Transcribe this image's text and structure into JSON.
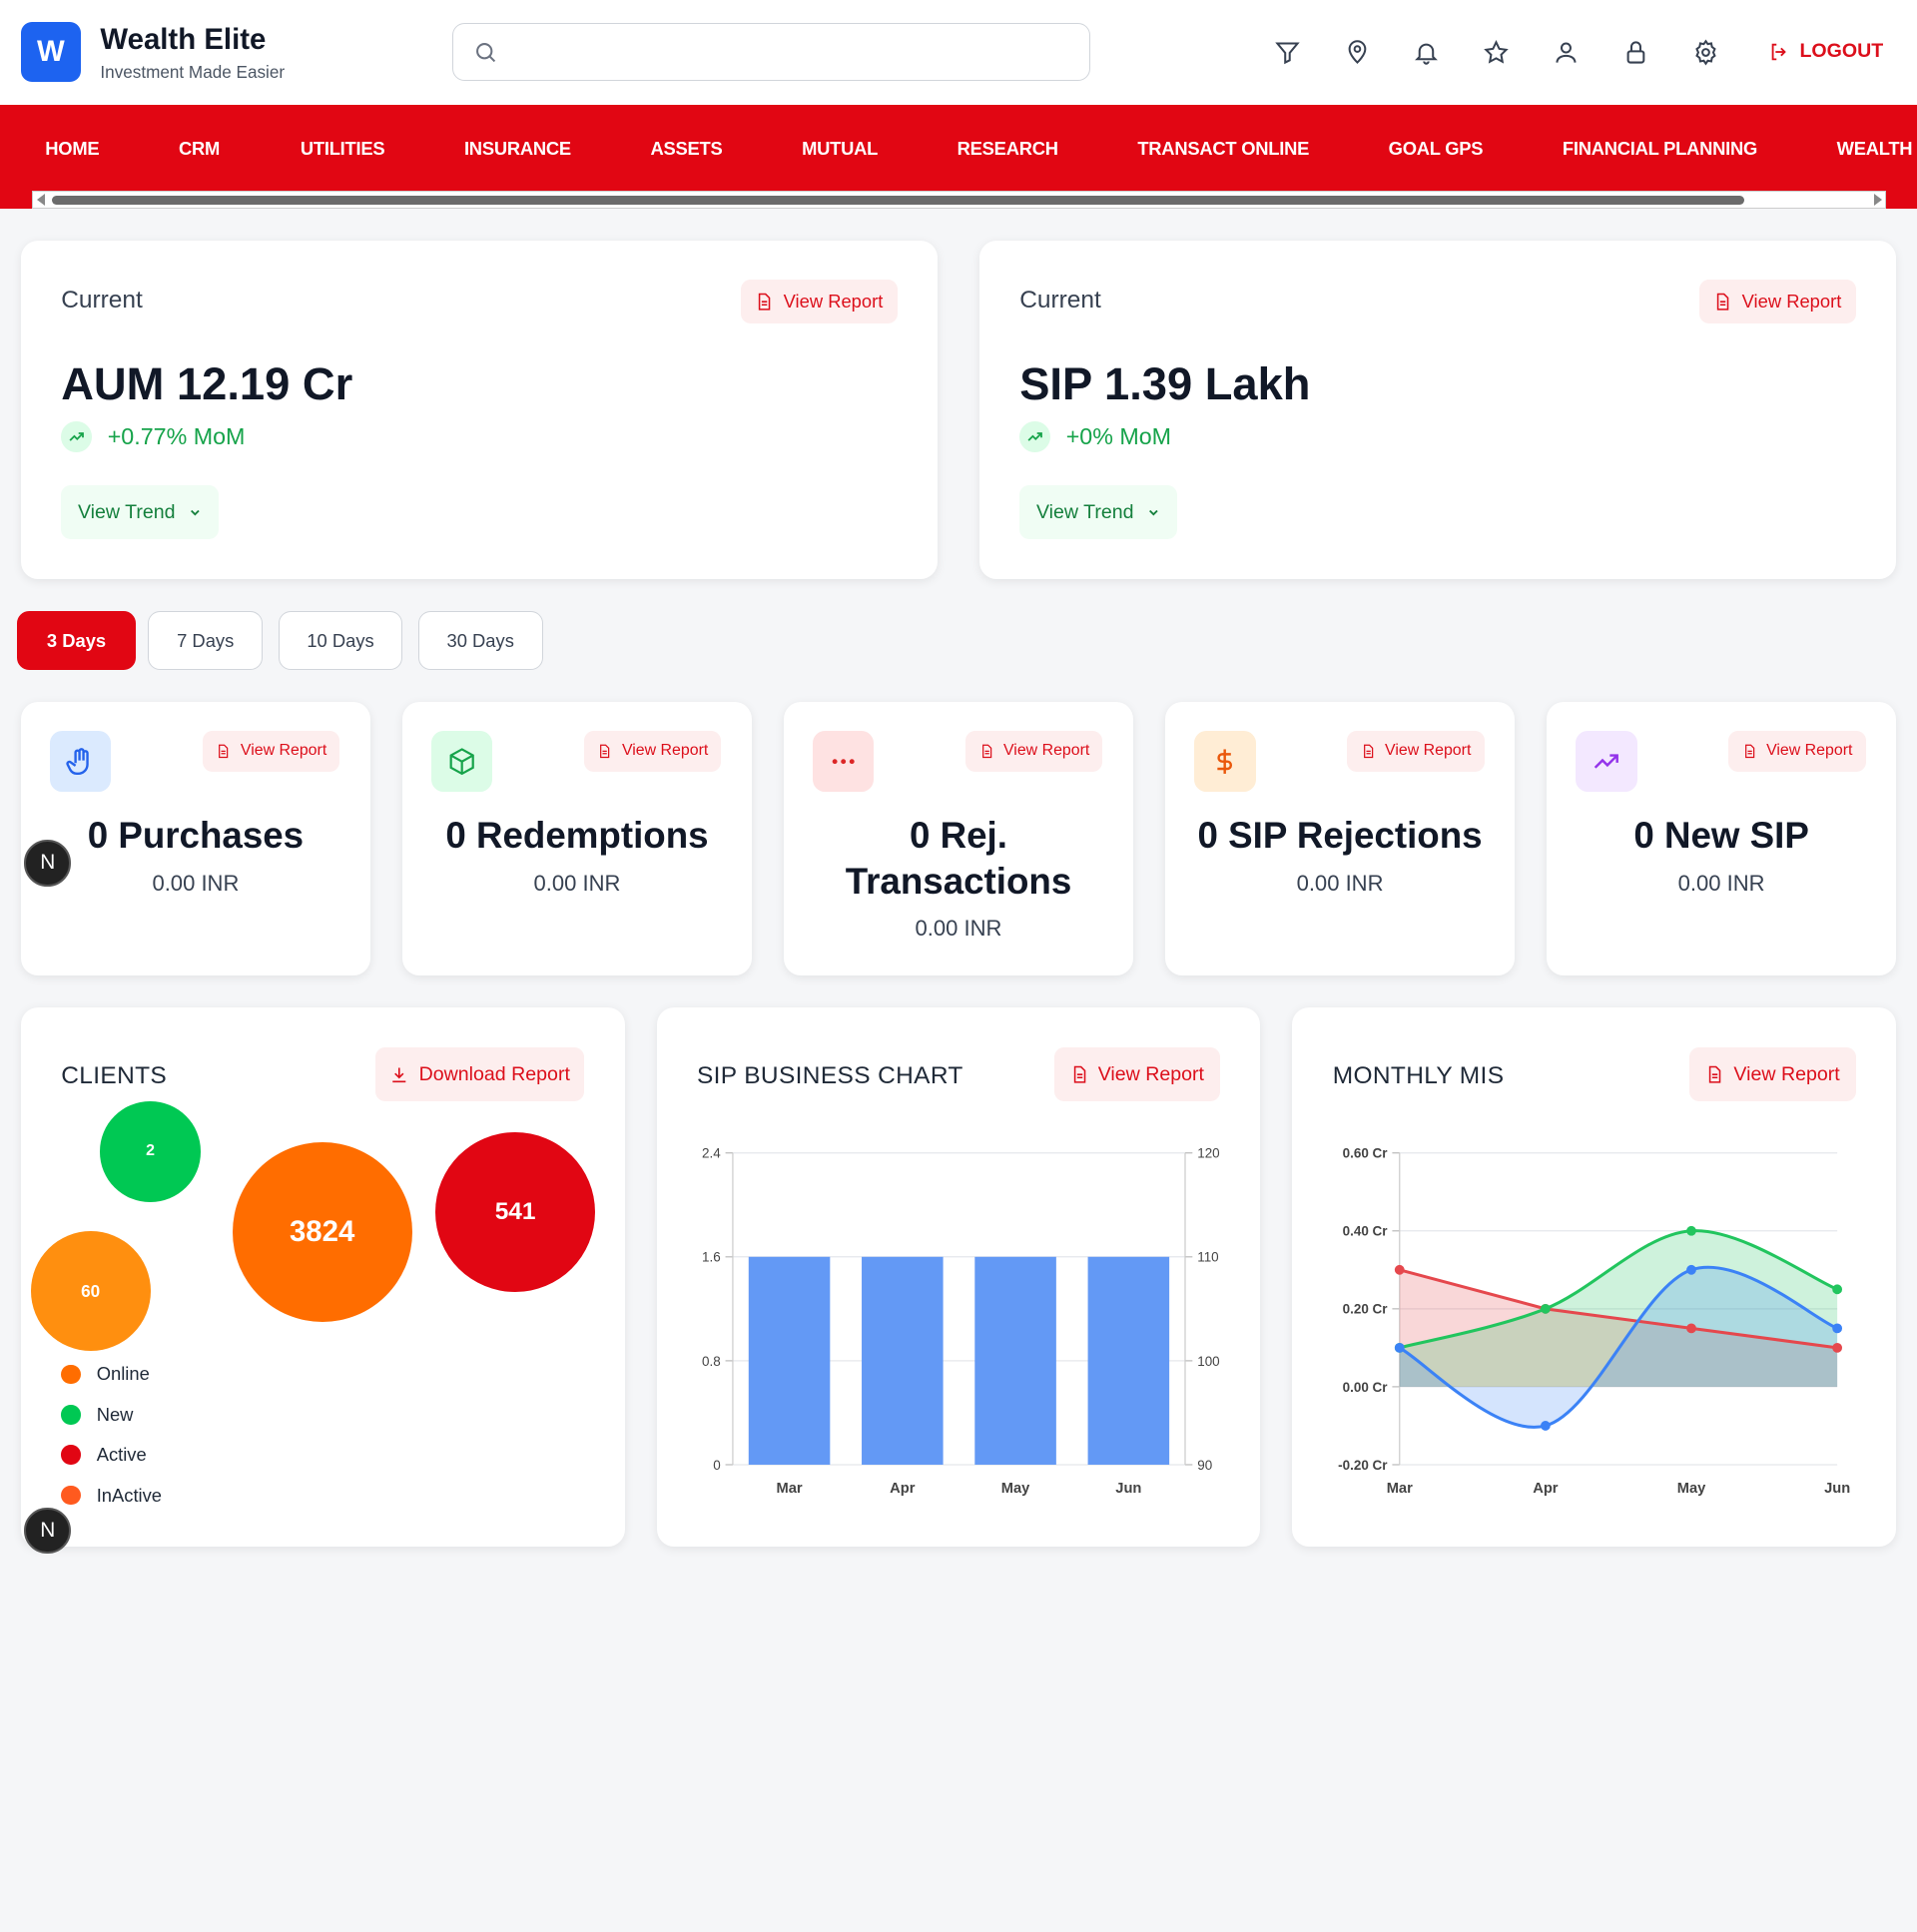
{
  "header": {
    "logo_letter": "W",
    "brand_title": "Wealth Elite",
    "brand_subtitle": "Investment Made Easier",
    "search_placeholder": "",
    "icons": [
      "filter-icon",
      "location-icon",
      "bell-icon",
      "star-icon",
      "user-icon",
      "lock-icon",
      "settings-icon"
    ],
    "logout_label": "LOGOUT"
  },
  "nav": {
    "items": [
      "HOME",
      "CRM",
      "UTILITIES",
      "INSURANCE",
      "ASSETS",
      "MUTUAL",
      "RESEARCH",
      "TRANSACT ONLINE",
      "GOAL GPS",
      "FINANCIAL PLANNING",
      "WEALTH REPORT"
    ]
  },
  "summary": [
    {
      "label": "Current",
      "value": "AUM 12.19 Cr",
      "change": "+0.77% MoM",
      "trend_label": "View Trend",
      "report_label": "View Report"
    },
    {
      "label": "Current",
      "value": "SIP 1.39 Lakh",
      "change": "+0% MoM",
      "trend_label": "View Trend",
      "report_label": "View Report"
    }
  ],
  "day_filters": {
    "selected": "3 Days",
    "options": [
      "3 Days",
      "7 Days",
      "10 Days",
      "30 Days"
    ]
  },
  "stat_cards": [
    {
      "icon": "hand-icon",
      "title": "0 Purchases",
      "amount": "0.00 INR",
      "report_label": "View Report",
      "color": "#2563eb",
      "bg": "#dbeafe"
    },
    {
      "icon": "box-icon",
      "title": "0 Redemptions",
      "amount": "0.00 INR",
      "report_label": "View Report",
      "color": "#16a34a",
      "bg": "#dcfce7"
    },
    {
      "icon": "dots-icon",
      "title": "0 Rej. Transactions",
      "amount": "0.00 INR",
      "report_label": "View Report",
      "color": "#dc2626",
      "bg": "#fee2e2"
    },
    {
      "icon": "dollar-icon",
      "title": "0 SIP Rejections",
      "amount": "0.00 INR",
      "report_label": "View Report",
      "color": "#ea580c",
      "bg": "#ffedd5"
    },
    {
      "icon": "trending-up-icon",
      "title": "0 New SIP",
      "amount": "0.00 INR",
      "report_label": "View Report",
      "color": "#9333ea",
      "bg": "#f3e8ff"
    }
  ],
  "clients": {
    "title": "CLIENTS",
    "download_label": "Download Report",
    "bubbles": [
      {
        "value": "2",
        "color": "#00c853"
      },
      {
        "value": "60",
        "color": "#ff8f0f"
      },
      {
        "value": "3824",
        "color": "#ff6d00"
      },
      {
        "value": "541",
        "color": "#e10613"
      }
    ],
    "legend": [
      {
        "label": "Online",
        "color": "#ff6d00"
      },
      {
        "label": "New",
        "color": "#00c853"
      },
      {
        "label": "Active",
        "color": "#e10613"
      },
      {
        "label": "InActive",
        "color": "#ff5a1f"
      }
    ]
  },
  "chart_data": [
    {
      "type": "bar",
      "title": "SIP BUSINESS CHART",
      "categories": [
        "Mar",
        "Apr",
        "May",
        "Jun"
      ],
      "series": [
        {
          "values": [
            1.6,
            1.6,
            1.6,
            1.6
          ],
          "color": "#6399f5"
        }
      ],
      "y_left_ticks": [
        "0",
        "0.8",
        "1.6",
        "2.4"
      ],
      "ylim_left": [
        0,
        2.4
      ],
      "y_right_ticks": [
        "90",
        "100",
        "110",
        "120"
      ],
      "ylim_right": [
        90,
        120
      ],
      "grid": true,
      "report_label": "View Report"
    },
    {
      "type": "area",
      "title": "MONTHLY MIS",
      "categories": [
        "Mar",
        "Apr",
        "May",
        "Jun"
      ],
      "series": [
        {
          "values": [
            0.3,
            0.2,
            0.15,
            0.1
          ],
          "color": "#e5484d"
        },
        {
          "values": [
            0.1,
            0.2,
            0.4,
            0.25
          ],
          "color": "#22c55e"
        },
        {
          "values": [
            0.1,
            -0.1,
            0.3,
            0.15
          ],
          "color": "#3b82f6"
        }
      ],
      "y_ticks": [
        "-0.20 Cr",
        "0.00 Cr",
        "0.20 Cr",
        "0.40 Cr",
        "0.60 Cr"
      ],
      "ylim": [
        -0.2,
        0.6
      ],
      "grid": true,
      "report_label": "View Report"
    }
  ]
}
